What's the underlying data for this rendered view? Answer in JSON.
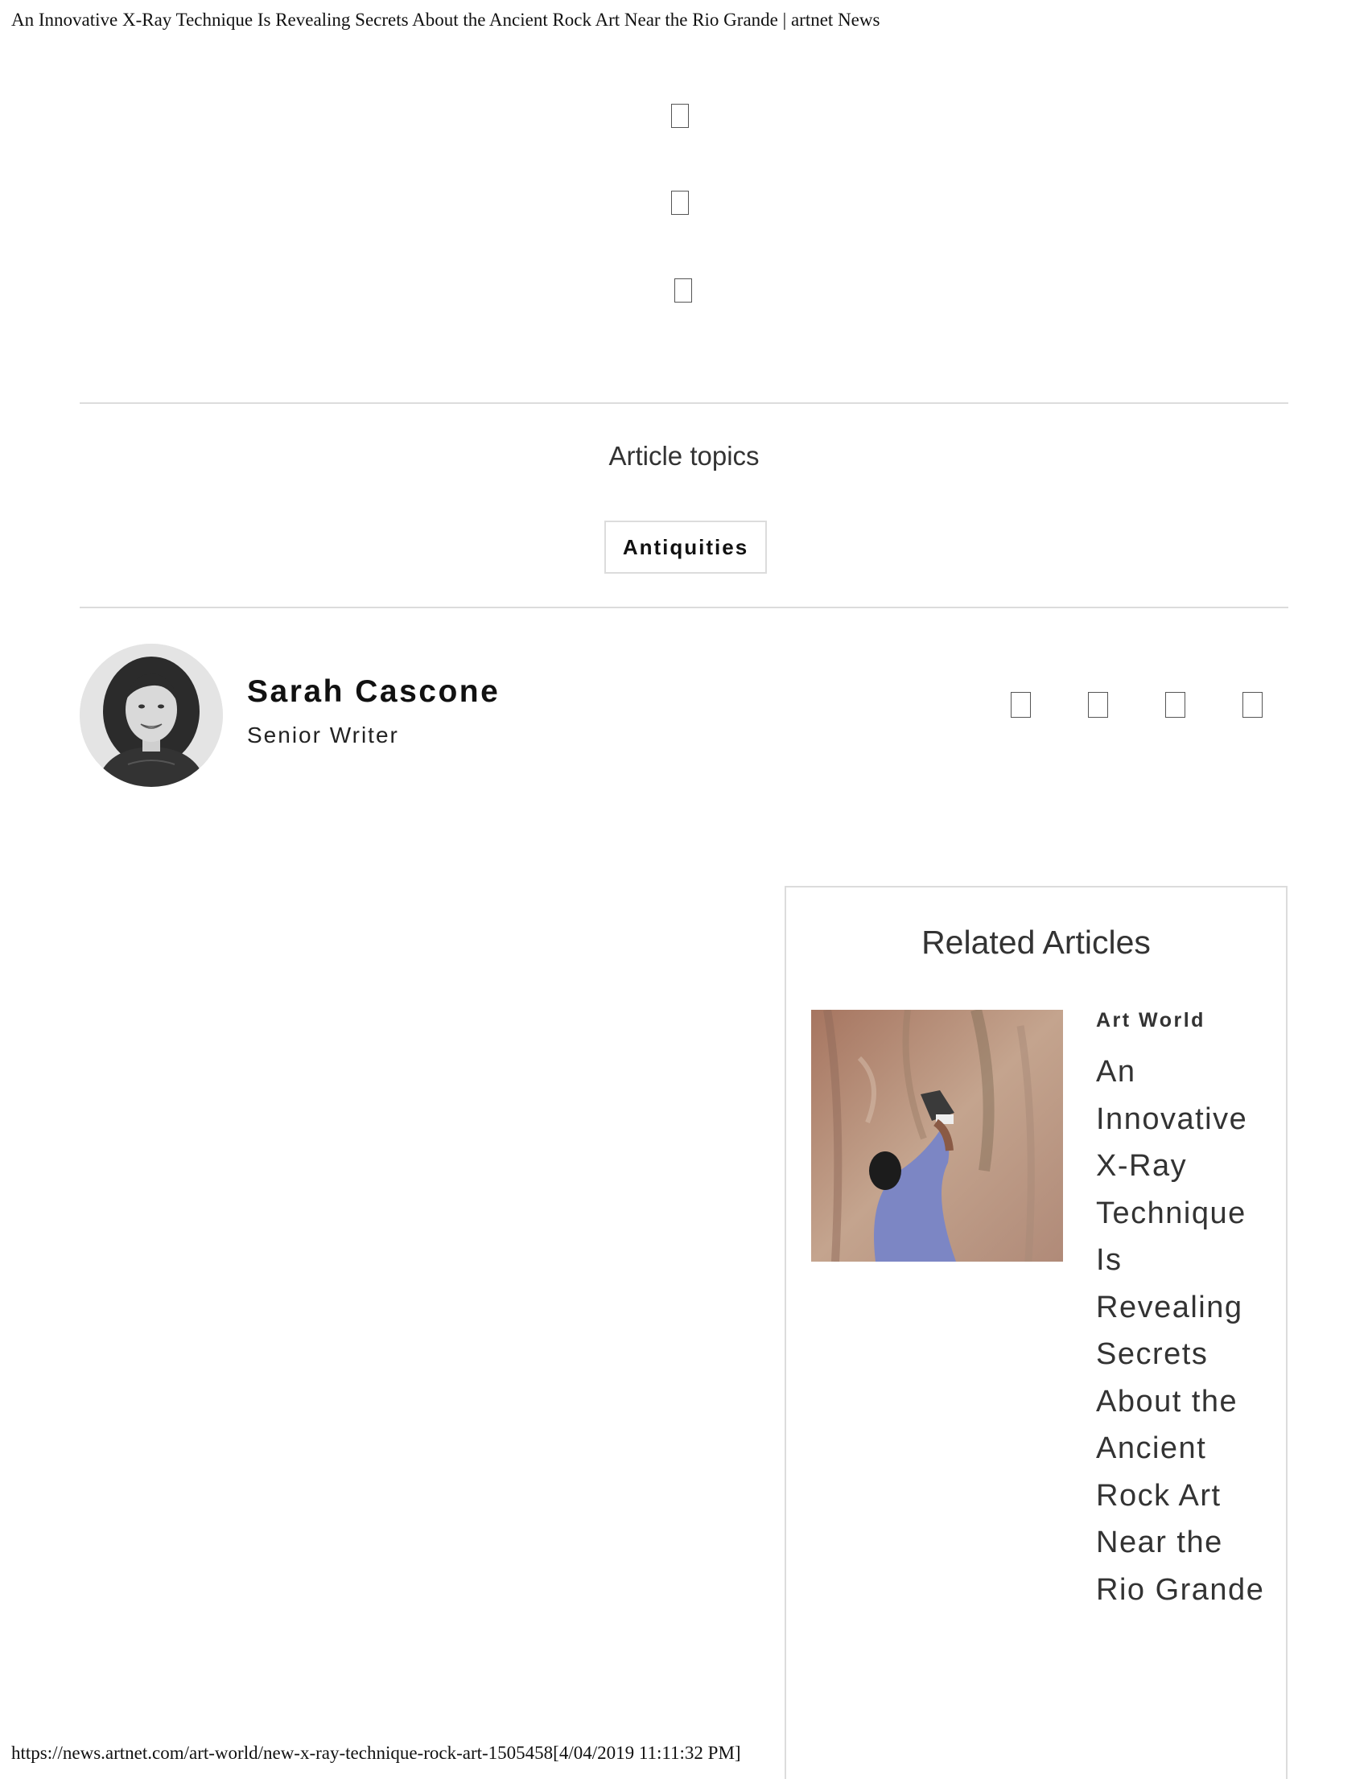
{
  "page_header": "An Innovative X-Ray Technique Is Revealing Secrets About the Ancient Rock Art Near the Rio Grande | artnet News",
  "share_icons": [
    "share-icon",
    "share-icon",
    "share-icon"
  ],
  "topics": {
    "title": "Article topics",
    "tags": [
      "Antiquities"
    ]
  },
  "author": {
    "name": "Sarah Cascone",
    "role": "Senior Writer",
    "social_icons": [
      "social-icon",
      "social-icon",
      "social-icon",
      "social-icon"
    ]
  },
  "related": {
    "title": "Related Articles",
    "items": [
      {
        "category": "Art World",
        "headline": "An Innovative X-Ray Technique Is Revealing Secrets About the Ancient Rock Art Near the Rio Grande"
      }
    ]
  },
  "page_footer": "https://news.artnet.com/art-world/new-x-ray-technique-rock-art-1505458[4/04/2019 11:11:32 PM]"
}
